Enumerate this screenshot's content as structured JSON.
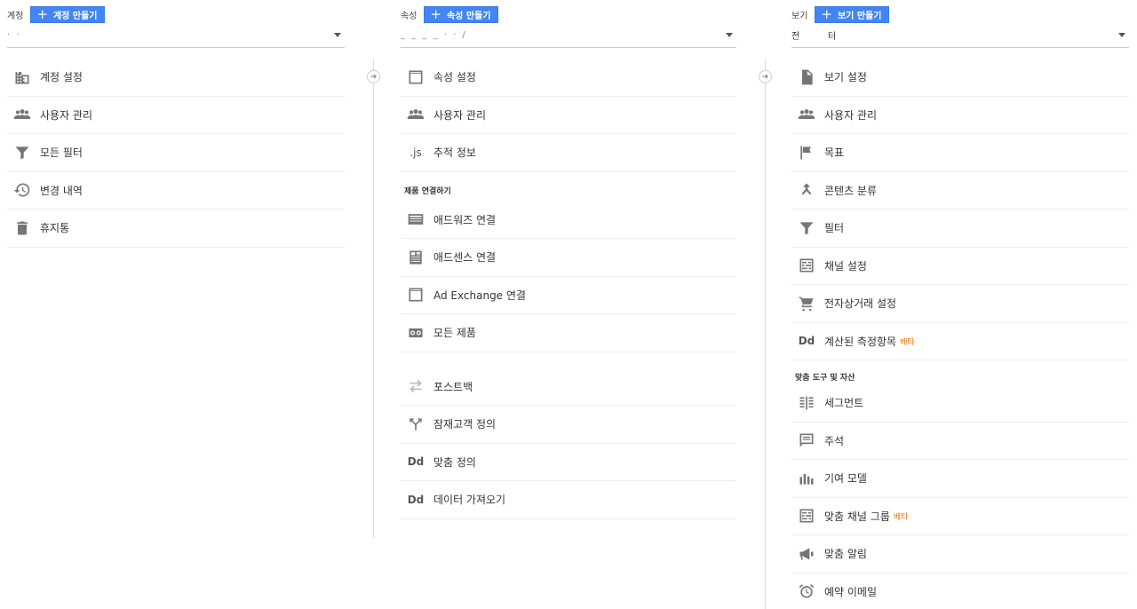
{
  "account": {
    "label": "계정",
    "create_label": "계정 만들기",
    "selector_value": "· ·",
    "items": [
      {
        "label": "계정 설정"
      },
      {
        "label": "사용자 관리"
      },
      {
        "label": "모든 필터"
      },
      {
        "label": "변경 내역"
      },
      {
        "label": "휴지통"
      }
    ]
  },
  "property": {
    "label": "속성",
    "create_label": "속성 만들기",
    "selector_value": "_ _ _ _ · · /",
    "items": [
      {
        "label": "속성 설정"
      },
      {
        "label": "사용자 관리"
      },
      {
        "label": "추적 정보",
        "icon_text": ".js"
      }
    ],
    "section_title": "제품 연결하기",
    "product_items": [
      {
        "label": "애드워즈 연결"
      },
      {
        "label": "애드센스 연결"
      },
      {
        "label": "Ad Exchange 연결"
      },
      {
        "label": "모든 제품"
      }
    ],
    "other_items": [
      {
        "label": "포스트백"
      },
      {
        "label": "잠재고객 정의"
      },
      {
        "label": "맞춤 정의",
        "icon_text": "Dd"
      },
      {
        "label": "데이터 가져오기",
        "icon_text": "Dd"
      }
    ]
  },
  "view": {
    "label": "보기",
    "create_label": "보기 만들기",
    "selector_value": "전          터",
    "items": [
      {
        "label": "보기 설정"
      },
      {
        "label": "사용자 관리"
      },
      {
        "label": "목표"
      },
      {
        "label": "콘텐츠 분류"
      },
      {
        "label": "필터"
      },
      {
        "label": "채널 설정"
      },
      {
        "label": "전자상거래 설정"
      },
      {
        "label": "계산된 측정항목",
        "icon_text": "Dd",
        "badge": "베타"
      }
    ],
    "section_title": "맞춤 도구 및 자산",
    "tool_items": [
      {
        "label": "세그먼트"
      },
      {
        "label": "주석"
      },
      {
        "label": "기여 모델"
      },
      {
        "label": "맞춤 채널 그룹",
        "badge": "베타"
      },
      {
        "label": "맞춤 알림"
      },
      {
        "label": "예약 이메일"
      }
    ]
  },
  "colors": {
    "accent": "#4285f4",
    "beta": "#e8710a",
    "icon": "#757575"
  }
}
